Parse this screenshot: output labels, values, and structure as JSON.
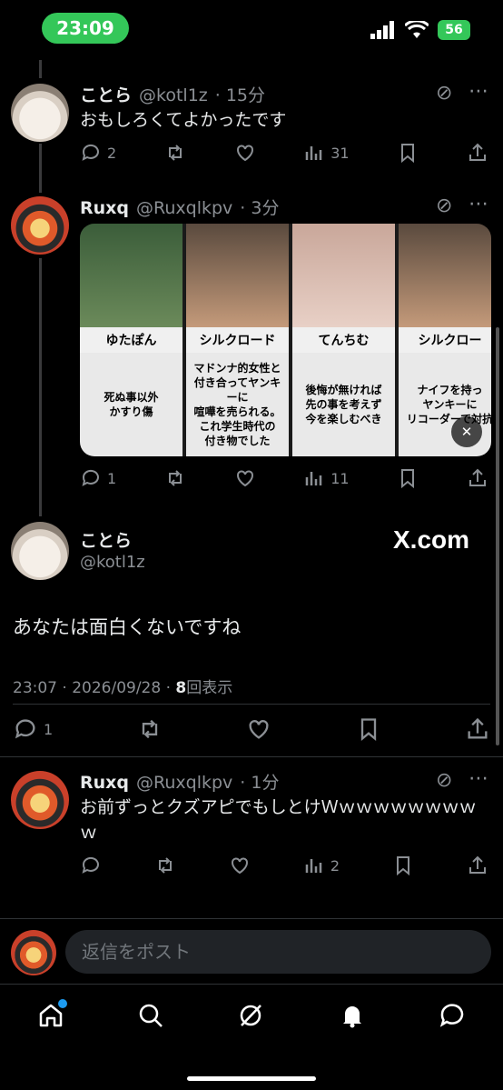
{
  "status_bar": {
    "time": "23:09",
    "battery": "56"
  },
  "tweets": [
    {
      "name": "ことら",
      "handle": "@kotl1z",
      "time": "· 15分",
      "text": "おもしろくてよかったです",
      "replies": "2",
      "views": "31"
    },
    {
      "name": "Ruxq",
      "handle": "@Ruxqlkpv",
      "time": "· 3分",
      "replies": "1",
      "views": "11",
      "media_cards": [
        {
          "name": "ゆたぽん",
          "quote": "死ぬ事以外\nかすり傷"
        },
        {
          "name": "シルクロード",
          "quote": "マドンナ的女性と\n付き合ってヤンキーに\n喧嘩を売られる。\nこれ学生時代の\n付き物でした"
        },
        {
          "name": "てんちむ",
          "quote": "後悔が無ければ\n先の事を考えず\n今を楽しむべき"
        },
        {
          "name": "シルクロー",
          "quote": "ナイフを持っ\nヤンキーに\nリコーダーで対抗"
        }
      ]
    }
  ],
  "main_tweet": {
    "name": "ことら",
    "handle": "@kotl1z",
    "watermark": "X.com",
    "text": "あなたは面白くないですね",
    "timestamp": "23:07 · 2026/09/28 · ",
    "view_count": "8",
    "view_label": "回表示",
    "replies": "1"
  },
  "reply_tweet": {
    "name": "Ruxq",
    "handle": "@Ruxqlkpv",
    "time": "· 1分",
    "text": "お前ずっとクズアピでもしとけＷｗｗｗｗｗｗｗｗｗ",
    "views": "2"
  },
  "reply_bar": {
    "placeholder": "返信をポスト"
  },
  "tabs": [
    "home-icon",
    "search-icon",
    "grok-icon",
    "notifications-icon",
    "messages-icon"
  ],
  "colors": {
    "accent": "#1d9bf0",
    "status_green": "#34c759",
    "secondary_text": "#8b8f94"
  }
}
